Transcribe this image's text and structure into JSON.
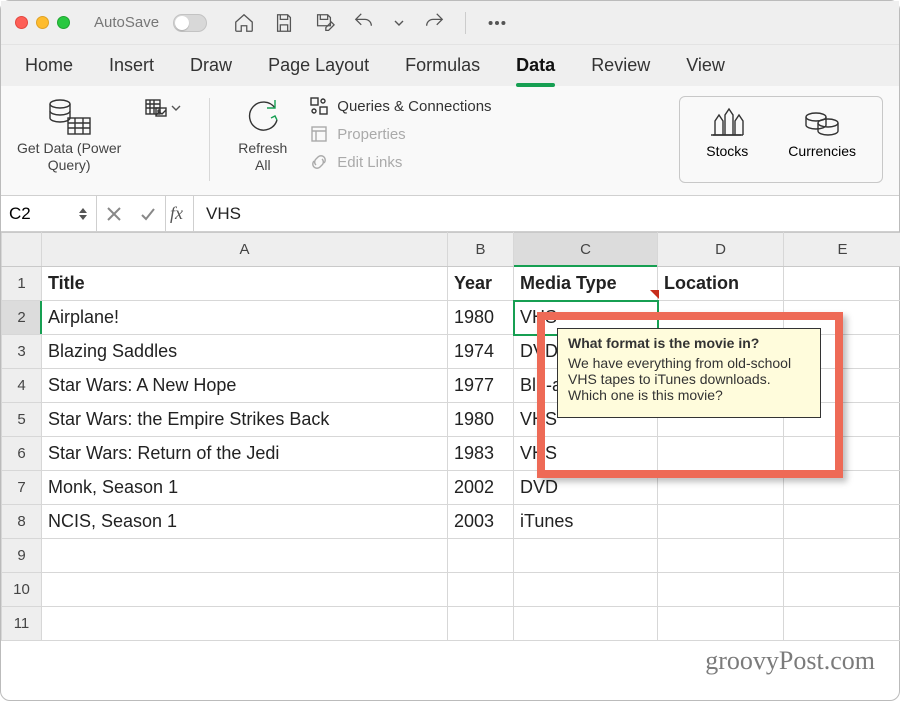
{
  "titlebar": {
    "autosave_label": "AutoSave"
  },
  "tabs": {
    "home": "Home",
    "insert": "Insert",
    "draw": "Draw",
    "page_layout": "Page Layout",
    "formulas": "Formulas",
    "data": "Data",
    "review": "Review",
    "view": "View"
  },
  "ribbon": {
    "get_data": "Get Data (Power\nQuery)",
    "refresh_all": "Refresh\nAll",
    "queries": "Queries & Connections",
    "properties": "Properties",
    "edit_links": "Edit Links",
    "stocks": "Stocks",
    "currencies": "Currencies"
  },
  "formula_bar": {
    "name_box": "C2",
    "fx_label": "fx",
    "value": "VHS"
  },
  "columns": [
    "A",
    "B",
    "C",
    "D",
    "E"
  ],
  "rows": [
    {
      "n": 1,
      "a": "Title",
      "b": "Year",
      "c": "Media Type",
      "d": "Location",
      "header": true
    },
    {
      "n": 2,
      "a": "Airplane!",
      "b": "1980",
      "c": "VHS",
      "d": ""
    },
    {
      "n": 3,
      "a": "Blazing Saddles",
      "b": "1974",
      "c": "DVD",
      "d": ""
    },
    {
      "n": 4,
      "a": "Star Wars: A New Hope",
      "b": "1977",
      "c": "Blu-a",
      "d": ""
    },
    {
      "n": 5,
      "a": "Star Wars: the Empire Strikes Back",
      "b": "1980",
      "c": "VHS",
      "d": ""
    },
    {
      "n": 6,
      "a": "Star Wars: Return of the Jedi",
      "b": "1983",
      "c": "VHS",
      "d": ""
    },
    {
      "n": 7,
      "a": "Monk, Season 1",
      "b": "2002",
      "c": "DVD",
      "d": ""
    },
    {
      "n": 8,
      "a": "NCIS, Season 1",
      "b": "2003",
      "c": "iTunes",
      "d": ""
    },
    {
      "n": 9,
      "a": "",
      "b": "",
      "c": "",
      "d": ""
    },
    {
      "n": 10,
      "a": "",
      "b": "",
      "c": "",
      "d": ""
    },
    {
      "n": 11,
      "a": "",
      "b": "",
      "c": "",
      "d": ""
    }
  ],
  "selected_cell": "C2",
  "comment": {
    "title": "What format is the movie in?",
    "body": "We have everything from old-school VHS tapes to iTunes downloads. Which one is this movie?"
  },
  "watermark": "groovyPost.com"
}
